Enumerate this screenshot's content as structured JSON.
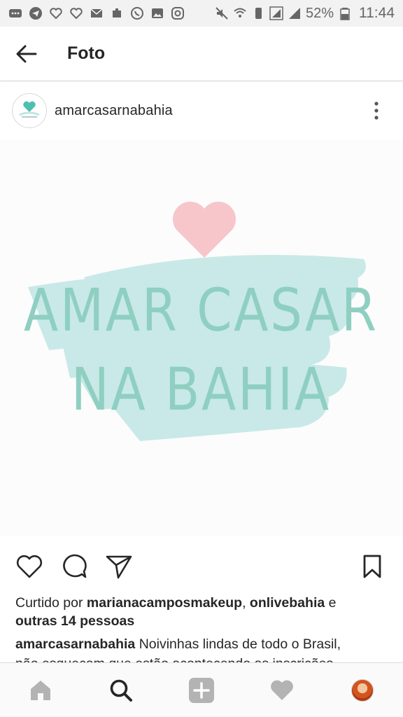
{
  "status_bar": {
    "battery_percent": "52%",
    "time": "11:44",
    "icons": [
      "notification-icon",
      "telegram-icon",
      "heart-outline-icon",
      "heart-outline-icon",
      "email-icon",
      "puzzle-icon",
      "whatsapp-icon",
      "gallery-icon",
      "instagram-icon",
      "mute-icon",
      "wifi-icon",
      "vibrate-icon",
      "signal-icon",
      "signal-icon",
      "battery-icon"
    ]
  },
  "app_bar": {
    "title": "Foto",
    "back_icon": "arrow-left-icon"
  },
  "post": {
    "username": "amarcasarnabahia",
    "avatar_icon": "heart-logo-icon",
    "more_icon": "more-vertical-icon",
    "image": {
      "line1": "AMAR CASAR",
      "line2": "NA BAHIA",
      "heart_color": "#f6c6cb",
      "brush_color": "#c6e8e6",
      "text_color": "#8fcfc2"
    },
    "actions": {
      "like_icon": "heart-outline-icon",
      "comment_icon": "comment-icon",
      "share_icon": "send-icon",
      "save_icon": "bookmark-icon"
    },
    "likes": {
      "prefix": "Curtido por ",
      "user1": "marianacamposmakeup",
      "separator": ", ",
      "user2": "onlivebahia",
      "connector": " e",
      "others": "outras 14 pessoas"
    },
    "caption": {
      "author": "amarcasarnabahia",
      "line1": " Noivinhas lindas de todo o Brasil,",
      "line2": "não esqueçam que estão acontecendo as inscrições"
    }
  },
  "bottom_nav": {
    "items": [
      "home-icon",
      "search-icon",
      "add-icon",
      "activity-heart-icon",
      "profile-avatar"
    ]
  }
}
